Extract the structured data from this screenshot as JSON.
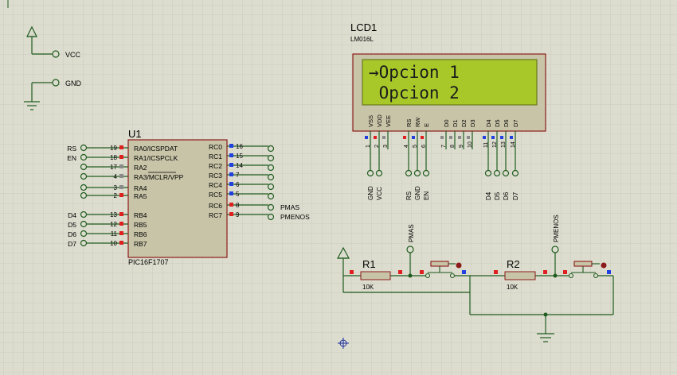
{
  "colors": {
    "background": "#ddddcf",
    "grid": "#c6c6ba",
    "wire": "#1f5c1f",
    "body_fill": "#c8c4a8",
    "body_stroke": "#8b1a1a",
    "lcd_screen": "#a8c82a",
    "pin_red": "#e02020",
    "pin_blue": "#2040e0",
    "pin_gray": "#8a8a8a"
  },
  "terminals": {
    "vcc_label": "VCC",
    "gnd_label": "GND"
  },
  "mcu": {
    "ref": "U1",
    "part": "PIC16F1707",
    "left_pins": [
      {
        "num": "19",
        "name": "RA0/ICSPDAT",
        "net": "RS"
      },
      {
        "num": "18",
        "name": "RA1/ICSPCLK",
        "net": "EN"
      },
      {
        "num": "17",
        "name": "RA2",
        "net": ""
      },
      {
        "num": "4",
        "name": "RA3/MCLR/VPP",
        "net": ""
      },
      {
        "num": "3",
        "name": "RA4",
        "net": ""
      },
      {
        "num": "2",
        "name": "RA5",
        "net": ""
      },
      {
        "num": "13",
        "name": "RB4",
        "net": "D4"
      },
      {
        "num": "12",
        "name": "RB5",
        "net": "D5"
      },
      {
        "num": "11",
        "name": "RB6",
        "net": "D6"
      },
      {
        "num": "10",
        "name": "RB7",
        "net": "D7"
      }
    ],
    "right_pins": [
      {
        "num": "16",
        "name": "RC0",
        "net": ""
      },
      {
        "num": "15",
        "name": "RC1",
        "net": ""
      },
      {
        "num": "14",
        "name": "RC2",
        "net": ""
      },
      {
        "num": "7",
        "name": "RC3",
        "net": ""
      },
      {
        "num": "6",
        "name": "RC4",
        "net": ""
      },
      {
        "num": "5",
        "name": "RC5",
        "net": ""
      },
      {
        "num": "8",
        "name": "RC6",
        "net": "PMAS"
      },
      {
        "num": "9",
        "name": "RC7",
        "net": "PMENOS"
      }
    ]
  },
  "lcd": {
    "ref": "LCD1",
    "part": "LM016L",
    "line1": "→Opcion 1",
    "line2": " Opcion 2",
    "pins": [
      {
        "num": "1",
        "name": "VSS",
        "net": "GND"
      },
      {
        "num": "2",
        "name": "VDD",
        "net": "VCC"
      },
      {
        "num": "3",
        "name": "VEE",
        "net": ""
      },
      {
        "num": "4",
        "name": "RS",
        "net": "RS"
      },
      {
        "num": "5",
        "name": "RW",
        "net": "GND"
      },
      {
        "num": "6",
        "name": "E",
        "net": "EN"
      },
      {
        "num": "7",
        "name": "D0",
        "net": ""
      },
      {
        "num": "8",
        "name": "D1",
        "net": ""
      },
      {
        "num": "9",
        "name": "D2",
        "net": ""
      },
      {
        "num": "10",
        "name": "D3",
        "net": ""
      },
      {
        "num": "11",
        "name": "D4",
        "net": "D4"
      },
      {
        "num": "12",
        "name": "D5",
        "net": "D5"
      },
      {
        "num": "13",
        "name": "D6",
        "net": "D6"
      },
      {
        "num": "14",
        "name": "D7",
        "net": "D7"
      }
    ]
  },
  "resistors": [
    {
      "ref": "R1",
      "value": "10K",
      "net": "PMAS"
    },
    {
      "ref": "R2",
      "value": "10K",
      "net": "PMENOS"
    }
  ]
}
